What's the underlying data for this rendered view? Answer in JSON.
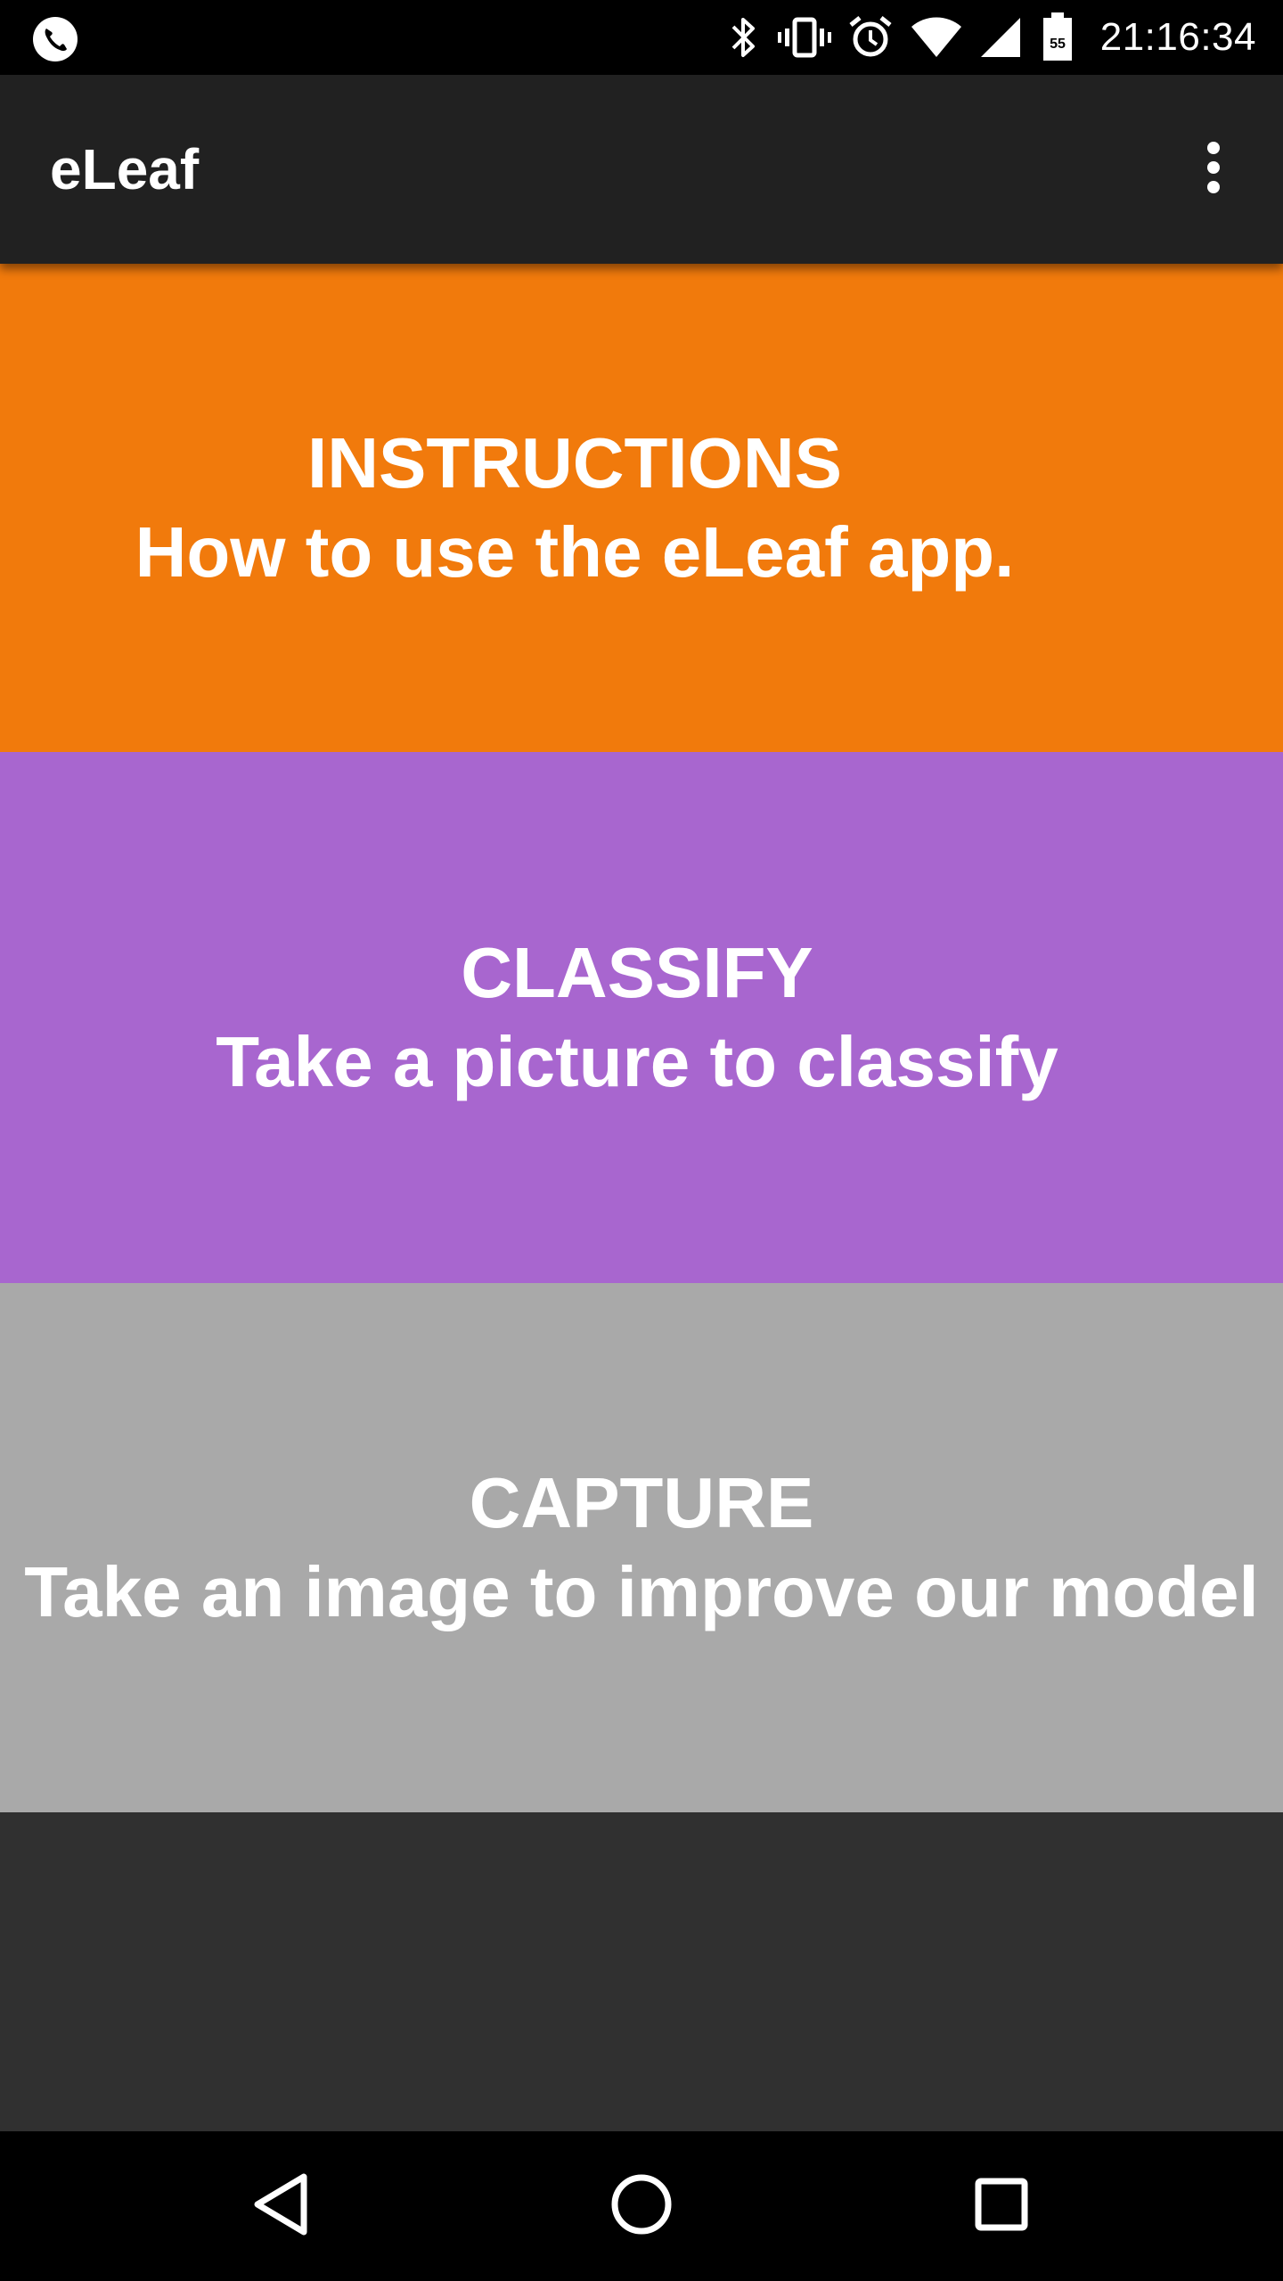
{
  "status_bar": {
    "time": "21:16:34",
    "battery_level": "55",
    "icons": [
      "phone-call-icon",
      "bluetooth-icon",
      "vibrate-icon",
      "alarm-icon",
      "wifi-icon",
      "cell-signal-icon",
      "battery-icon"
    ]
  },
  "app_bar": {
    "title": "eLeaf",
    "menu_icon": "overflow-menu-icon"
  },
  "cards": {
    "instructions": {
      "title": "INSTRUCTIONS",
      "subtitle": "How to use the eLeaf app.",
      "color": "#f17a0c"
    },
    "classify": {
      "title": "CLASSIFY",
      "subtitle": "Take a picture to classify",
      "color": "#a866cf"
    },
    "capture": {
      "title": "CAPTURE",
      "subtitle": "Take an image to improve our model",
      "color": "#a9a9a9"
    }
  },
  "nav_bar": {
    "icons": [
      "back-icon",
      "home-icon",
      "recents-icon"
    ]
  },
  "colors": {
    "status_bar": "#000000",
    "app_bar": "#212121",
    "background": "#303030",
    "text": "#ffffff"
  }
}
